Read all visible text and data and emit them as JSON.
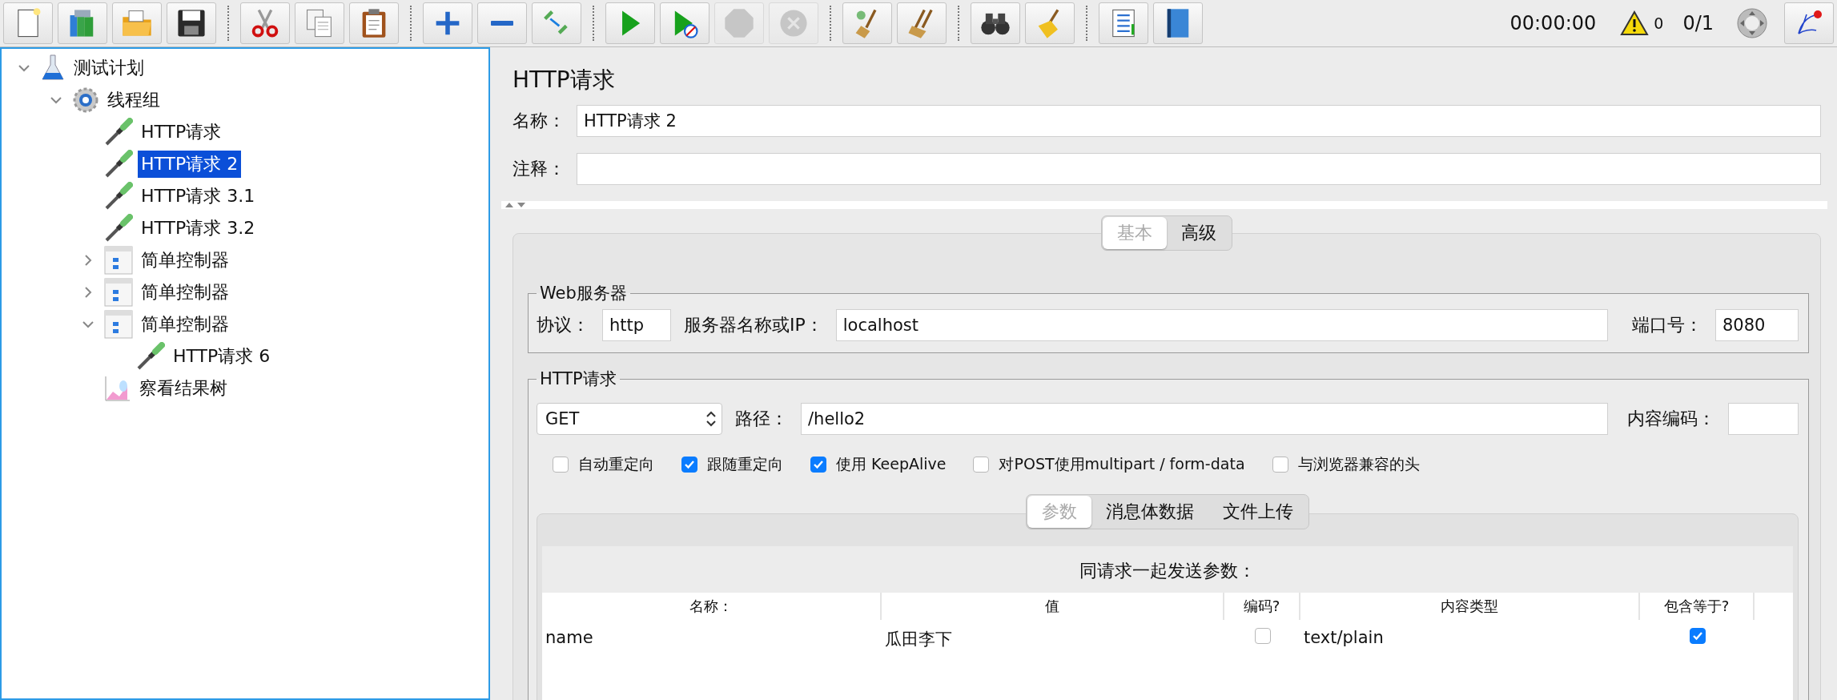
{
  "toolbar": {
    "groups": [
      [
        {
          "kind": "new",
          "disabled": false
        },
        {
          "kind": "templates",
          "disabled": false
        },
        {
          "kind": "open",
          "disabled": false
        },
        {
          "kind": "save",
          "disabled": false
        }
      ],
      [
        {
          "kind": "cut",
          "disabled": false
        },
        {
          "kind": "copy",
          "disabled": false
        },
        {
          "kind": "paste",
          "disabled": false
        }
      ],
      [
        {
          "kind": "expand",
          "disabled": false
        },
        {
          "kind": "collapse",
          "disabled": false
        },
        {
          "kind": "toggle",
          "disabled": false
        }
      ],
      [
        {
          "kind": "start",
          "disabled": false
        },
        {
          "kind": "start-no-pauses",
          "disabled": false
        },
        {
          "kind": "stop",
          "disabled": true
        },
        {
          "kind": "shutdown",
          "disabled": true
        }
      ],
      [
        {
          "kind": "clear",
          "disabled": false
        },
        {
          "kind": "clear-all",
          "disabled": false
        }
      ],
      [
        {
          "kind": "search",
          "disabled": false
        },
        {
          "kind": "reset-search",
          "disabled": false
        }
      ],
      [
        {
          "kind": "functions",
          "disabled": false
        },
        {
          "kind": "help",
          "disabled": false
        }
      ]
    ],
    "timer": "00:00:00",
    "warnings": "0",
    "threads": "0/1"
  },
  "tree": [
    {
      "label": "测试计划",
      "kind": "plan",
      "expanded": true,
      "selected": false,
      "children": [
        {
          "label": "线程组",
          "kind": "thread-group",
          "expanded": true,
          "selected": false,
          "children": [
            {
              "label": "HTTP请求",
              "kind": "sampler",
              "selected": false
            },
            {
              "label": "HTTP请求 2",
              "kind": "sampler",
              "selected": true
            },
            {
              "label": "HTTP请求 3.1",
              "kind": "sampler",
              "selected": false
            },
            {
              "label": "HTTP请求 3.2",
              "kind": "sampler",
              "selected": false
            },
            {
              "label": "简单控制器",
              "kind": "controller",
              "expanded": false,
              "selected": false
            },
            {
              "label": "简单控制器",
              "kind": "controller",
              "expanded": false,
              "selected": false
            },
            {
              "label": "简单控制器",
              "kind": "controller",
              "expanded": true,
              "selected": false,
              "children": [
                {
                  "label": "HTTP请求 6",
                  "kind": "sampler",
                  "selected": false
                }
              ]
            },
            {
              "label": "察看结果树",
              "kind": "listener",
              "selected": false
            }
          ]
        }
      ]
    }
  ],
  "editor": {
    "title": "HTTP请求",
    "name_label": "名称：",
    "name_value": "HTTP请求 2",
    "comment_label": "注释：",
    "tabs": [
      {
        "label": "基本",
        "selected": true
      },
      {
        "label": "高级",
        "selected": false
      }
    ],
    "web_server": {
      "legend": "Web服务器",
      "protocol_label": "协议：",
      "protocol": "http",
      "server_label": "服务器名称或IP：",
      "server": "localhost",
      "port_label": "端口号：",
      "port": "8080"
    },
    "http_request": {
      "legend": "HTTP请求",
      "method": "GET",
      "path_label": "路径：",
      "path": "/hello2",
      "encoding_label": "内容编码：",
      "options": [
        {
          "label": "自动重定向",
          "checked": false
        },
        {
          "label": "跟随重定向",
          "checked": true
        },
        {
          "label": "使用 KeepAlive",
          "checked": true
        },
        {
          "label": "对POST使用multipart / form-data",
          "checked": false
        },
        {
          "label": "与浏览器兼容的头",
          "checked": false
        }
      ],
      "tabs": [
        {
          "label": "参数",
          "selected": true
        },
        {
          "label": "消息体数据",
          "selected": false
        },
        {
          "label": "文件上传",
          "selected": false
        }
      ],
      "params": {
        "title": "同请求一起发送参数：",
        "columns": [
          "名称：",
          "值",
          "编码?",
          "内容类型",
          "包含等于?"
        ],
        "rows": [
          {
            "name": "name",
            "value": "瓜田李下",
            "encode": false,
            "content_type": "text/plain",
            "include_equals": true
          }
        ]
      }
    }
  }
}
